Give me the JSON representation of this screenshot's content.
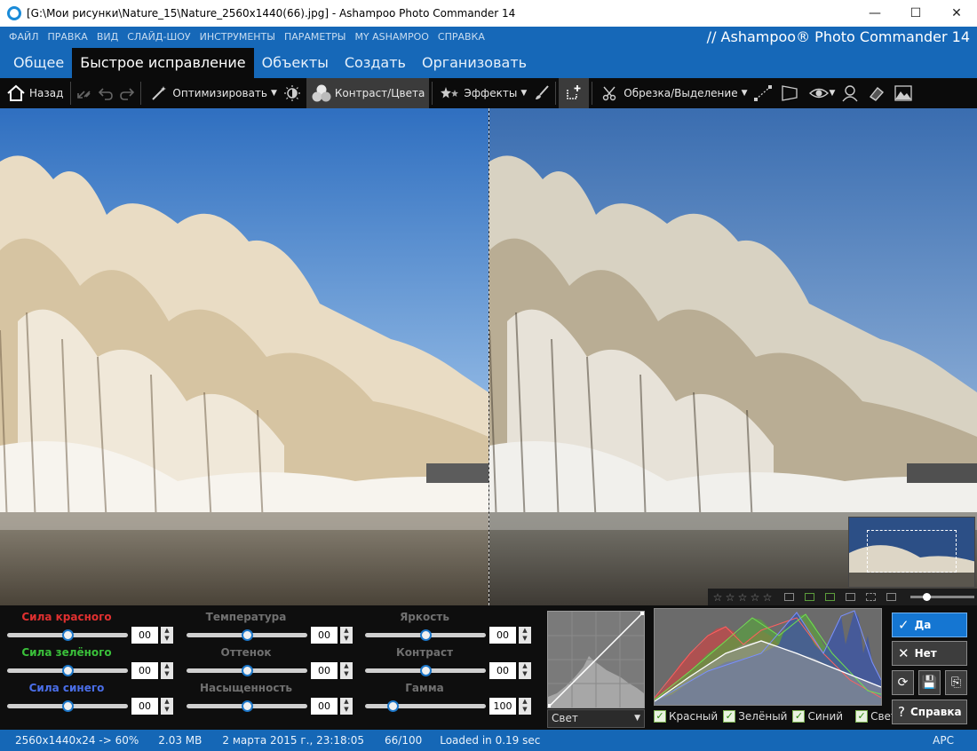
{
  "window": {
    "title": "[G:\\Мои рисунки\\Nature_15\\Nature_2560x1440(66).jpg] - Ashampoo Photo Commander 14",
    "minimize": "—",
    "maximize": "☐",
    "close": "✕"
  },
  "menu": {
    "items": [
      "ФАЙЛ",
      "ПРАВКА",
      "ВИД",
      "СЛАЙД-ШОУ",
      "ИНСТРУМЕНТЫ",
      "ПАРАМЕТРЫ",
      "MY ASHAMPOO",
      "СПРАВКА"
    ],
    "brand": "// Ashampoo® Photo Commander 14"
  },
  "tabs": [
    "Общее",
    "Быстрое исправление",
    "Объекты",
    "Создать",
    "Организовать"
  ],
  "active_tab": "Быстрое исправление",
  "toolbar": {
    "back": "Назад",
    "optimize": "Оптимизировать",
    "contrast": "Контраст/Цвета",
    "effects": "Эффекты",
    "crop": "Обрезка/Выделение"
  },
  "sliders": [
    {
      "label": "Сила красного",
      "value": "00",
      "level": 0.5
    },
    {
      "label": "Сила зелёного",
      "value": "00",
      "level": 0.5
    },
    {
      "label": "Сила синего",
      "value": "00",
      "level": 0.5
    },
    {
      "label": "Температура",
      "value": "00",
      "level": 0.5
    },
    {
      "label": "Оттенок",
      "value": "00",
      "level": 0.5
    },
    {
      "label": "Насыщенность",
      "value": "00",
      "level": 0.5
    },
    {
      "label": "Яркость",
      "value": "00",
      "level": 0.5
    },
    {
      "label": "Контраст",
      "value": "00",
      "level": 0.5
    },
    {
      "label": "Гамма",
      "value": "100",
      "level": 0.23
    }
  ],
  "curve": {
    "channel": "Свет"
  },
  "histogram": {
    "legend": [
      "Красный",
      "Зелёный",
      "Синий",
      "Свет"
    ]
  },
  "actions": {
    "yes": "Да",
    "no": "Нет",
    "help": "Справка"
  },
  "status": {
    "dimensions": "2560x1440x24 -> 60%",
    "size": "2.03 MB",
    "date": "2 марта 2015 г., 23:18:05",
    "index": "66/100",
    "load": "Loaded in 0.19 sec",
    "lang": "АРС"
  },
  "colors": {
    "accent": "#1668b8",
    "red_label": "#e03030",
    "green_label": "#3ac03a",
    "blue_label": "#4a6ee8",
    "yes_button": "#1576d2"
  }
}
